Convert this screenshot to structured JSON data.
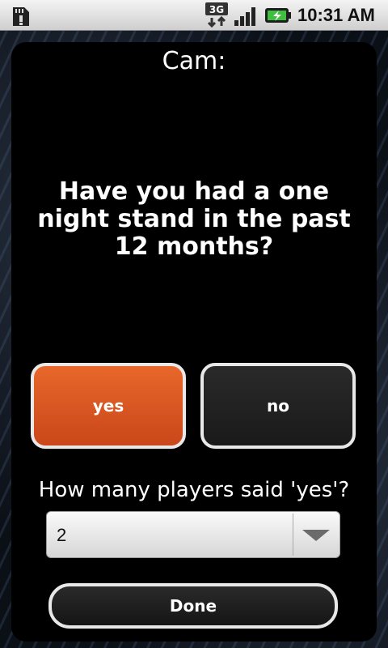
{
  "status_bar": {
    "network_label": "3G",
    "time": "10:31 AM",
    "icons": [
      "sd-card-icon",
      "network-3g-icon",
      "signal-icon",
      "battery-charging-icon"
    ]
  },
  "game": {
    "player": "Cam:",
    "question": "Have you had a one night stand in the past 12 months?",
    "answers": {
      "yes": "yes",
      "no": "no"
    },
    "selected_answer": "yes",
    "count_prompt": "How many players said 'yes'?",
    "count_value": "2",
    "done_label": "Done"
  },
  "colors": {
    "accent": "#d9541f",
    "button_dark": "#222222",
    "status_bar": "#e4e4e4"
  }
}
